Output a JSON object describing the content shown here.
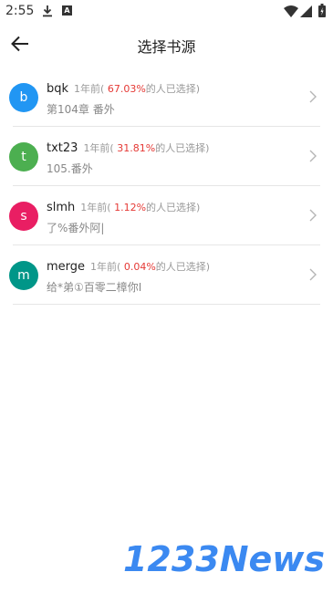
{
  "status": {
    "time": "2:55"
  },
  "app_bar": {
    "title": "选择书源"
  },
  "colors": {
    "percent": "#e53935",
    "watermark": "#2b7ff0"
  },
  "sources": [
    {
      "initial": "b",
      "avatar_color": "#2196f3",
      "name": "bqk",
      "meta_prefix": "1年前(",
      "percent": " 67.03%",
      "meta_suffix": "的人已选择)",
      "chapter": "第104章 番外"
    },
    {
      "initial": "t",
      "avatar_color": "#4caf50",
      "name": "txt23",
      "meta_prefix": "1年前(",
      "percent": " 31.81%",
      "meta_suffix": "的人已选择)",
      "chapter": "105.番外"
    },
    {
      "initial": "s",
      "avatar_color": "#e91e63",
      "name": "slmh",
      "meta_prefix": "1年前(",
      "percent": " 1.12%",
      "meta_suffix": "的人已选择)",
      "chapter": "了%番外阿|"
    },
    {
      "initial": "m",
      "avatar_color": "#009688",
      "name": "merge",
      "meta_prefix": "1年前(",
      "percent": " 0.04%",
      "meta_suffix": "的人已选择)",
      "chapter": "给*弟①百零二樟你I"
    }
  ],
  "watermark": {
    "text": "1233News"
  }
}
